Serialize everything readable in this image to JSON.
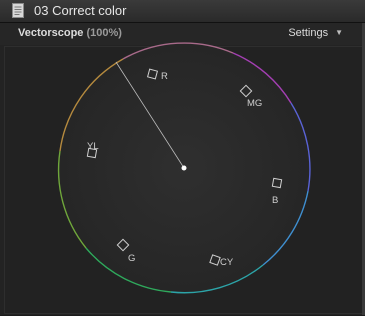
{
  "window": {
    "title": "03 Correct color"
  },
  "header": {
    "scope_name": "Vectorscope",
    "scope_percent": "(100%)",
    "settings_label": "Settings",
    "settings_caret": "▼"
  },
  "vectorscope": {
    "targets": [
      {
        "label": "R"
      },
      {
        "label": "MG"
      },
      {
        "label": "B"
      },
      {
        "label": "CY"
      },
      {
        "label": "G"
      },
      {
        "label": "YL"
      }
    ]
  }
}
